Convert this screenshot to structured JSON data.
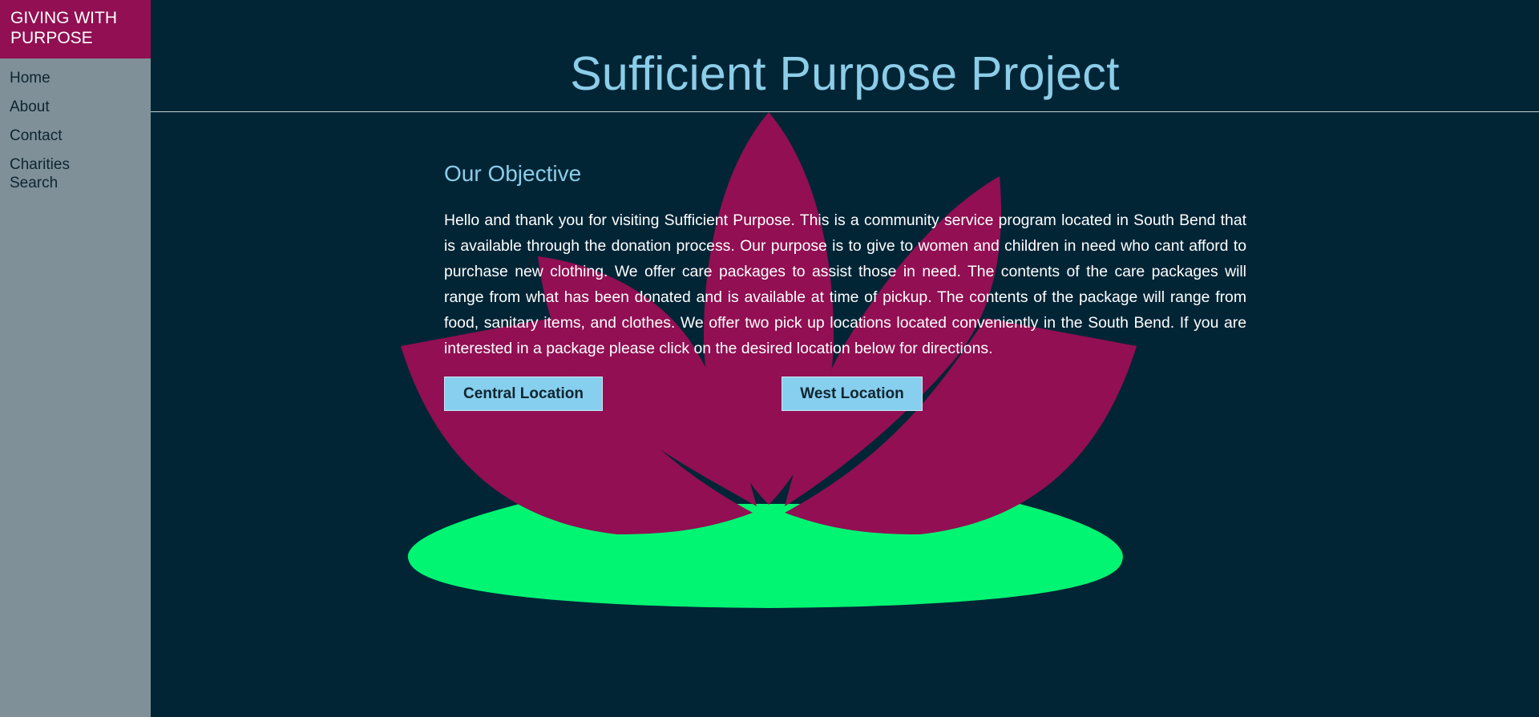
{
  "sidebar": {
    "brand": "GIVING WITH PURPOSE",
    "items": [
      {
        "label": "Home"
      },
      {
        "label": "About"
      },
      {
        "label": "Contact"
      },
      {
        "label": "Charities Search"
      }
    ]
  },
  "header": {
    "title": "Sufficient Purpose Project"
  },
  "main": {
    "section_title": "Our Objective",
    "intro": "Hello and thank you for visiting Sufficient Purpose. This is a community service program located in South Bend that is available through the donation process. Our purpose is to give to women and children in need who cant afford to purchase new clothing. We offer care packages to assist those in need. The contents of the care packages will range from what has been donated and is available at time of pickup. The contents of the package will range from food, sanitary items, and clothes. We offer two pick up locations located conveniently in the South Bend. If you are interested in a package please click on the desired location below for directions.",
    "buttons": {
      "central": "Central Location",
      "west": "West Location"
    }
  },
  "colors": {
    "background": "#022536",
    "sidebar": "#7f9098",
    "brand": "#910f52",
    "accent": "#8ccde8",
    "petal": "#910f52",
    "lily_pad": "#02f572"
  },
  "icons": {
    "background_art": "lotus-flower-icon"
  }
}
